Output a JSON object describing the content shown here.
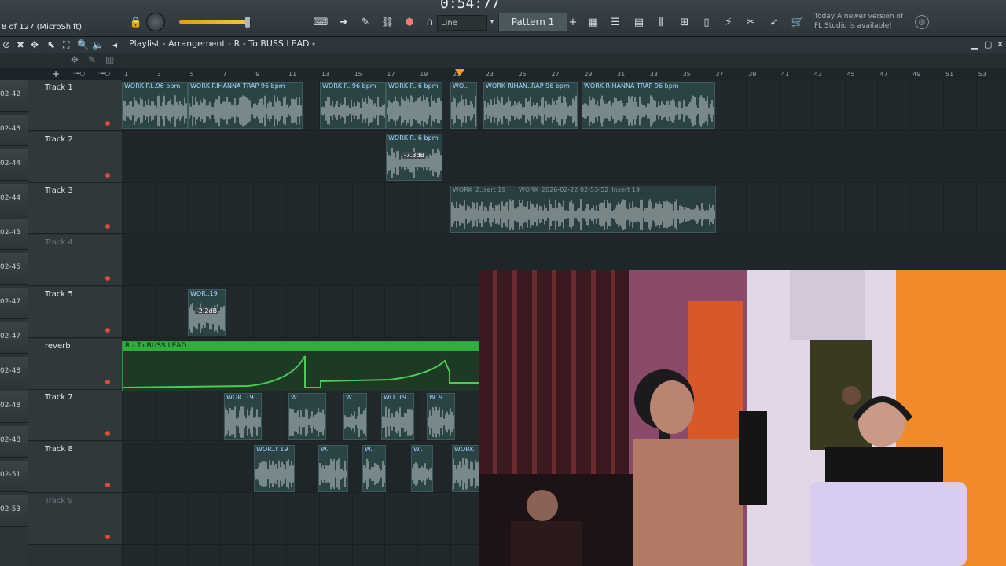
{
  "status": {
    "text": "8 of 127 (MicroShift)"
  },
  "transport": {
    "clock": "0:54:77",
    "snap": "Line",
    "pattern": "Pattern 1"
  },
  "news": {
    "line1": "Today  A newer version of",
    "line2": "FL Studio is available!"
  },
  "playlist": {
    "title": "Playlist - Arrangement",
    "breadcrumb": "R - To BUSS LEAD"
  },
  "ruler_ticks": [
    "1",
    "3",
    "5",
    "7",
    "9",
    "11",
    "13",
    "15",
    "17",
    "19",
    "21",
    "23",
    "25",
    "27",
    "29",
    "31",
    "33",
    "35",
    "37",
    "39",
    "41",
    "43",
    "45",
    "47",
    "49",
    "51",
    "53"
  ],
  "left_items": [
    "02-42",
    "02-43",
    "02-44",
    "02-44",
    "02-45",
    "02-45",
    "02-47",
    "02-47",
    "02-48",
    "02-48",
    "02-48",
    "02-51",
    "02-53"
  ],
  "tracks": [
    {
      "name": "Track 1",
      "dim": false
    },
    {
      "name": "Track 2",
      "dim": false
    },
    {
      "name": "Track 3",
      "dim": false
    },
    {
      "name": "Track 4",
      "dim": true
    },
    {
      "name": "Track 5",
      "dim": false
    },
    {
      "name": "reverb",
      "dim": false
    },
    {
      "name": "Track 7",
      "dim": false
    },
    {
      "name": "Track 8",
      "dim": false
    },
    {
      "name": "Track 9",
      "dim": true
    }
  ],
  "clips": {
    "t1a": "WORK RI..96 bpm",
    "t1b": "WORK RIHANNA TRAP 96 bpm",
    "t1c": "WORK R..96 bpm",
    "t1d": "WORK R..6 bpm",
    "t1e": "WO..",
    "t1f": "WORK RIHAN..RAP 96 bpm",
    "t1g": "WORK RIHANNA TRAP 96 bpm",
    "t2": "WORK R..6 bpm",
    "t2db": "-7.3dB",
    "t3a": "WORK_2..sert 19",
    "t3b": "WORK_2026-02-22 02-53-52_Insert 19",
    "t5": "WOR..19",
    "t5db": "-2.2dB",
    "auto": "R - To BUSS LEAD",
    "t7a": "WOR..19",
    "t7b": "W..",
    "t7c": "W..",
    "t7d": "WO..19",
    "t7e": "W..9",
    "t8a": "WOR..t 19",
    "t8b": "W..",
    "t8c": "W..",
    "t8d": "W..",
    "t8e": "WORK"
  },
  "colors": {
    "accent": "#f0a020",
    "clip_label": "#a9d6ff",
    "automation": "#2fae3f",
    "mute_led": "#e04a3a"
  }
}
